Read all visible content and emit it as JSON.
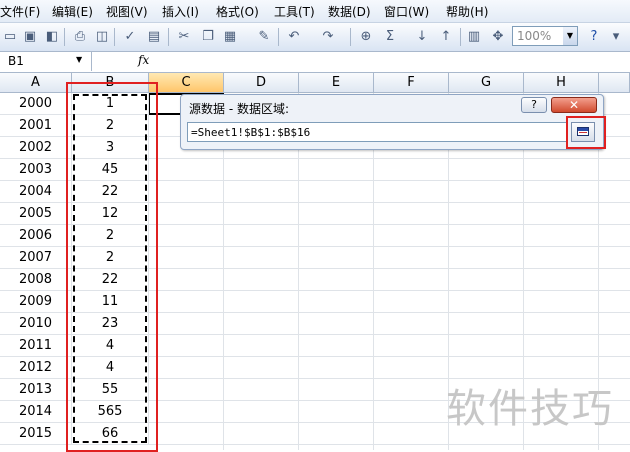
{
  "menu": [
    "文件(F)",
    "编辑(E)",
    "视图(V)",
    "插入(I)",
    "格式(O)",
    "工具(T)",
    "数据(D)",
    "窗口(W)",
    "帮助(H)"
  ],
  "toolbar": {
    "zoom_value": "100%",
    "icons": [
      "new-icon",
      "save-icon",
      "permission-icon",
      "print-icon",
      "print-preview-icon",
      "spelling-icon",
      "research-icon",
      "cut-icon",
      "copy-icon",
      "paste-icon",
      "format-painter-icon",
      "undo-icon",
      "redo-icon",
      "hyperlink-icon",
      "autosum-icon",
      "sort-ascending-icon",
      "sort-descending-icon",
      "chart-wizard-icon",
      "drawing-icon",
      "help-icon"
    ]
  },
  "formula_bar": {
    "name_box": "B1",
    "fx_label": "fx"
  },
  "columns": [
    "A",
    "B",
    "C",
    "D",
    "E",
    "F",
    "G",
    "H"
  ],
  "rows": [
    {
      "a": "2000",
      "b": "1"
    },
    {
      "a": "2001",
      "b": "2"
    },
    {
      "a": "2002",
      "b": "3"
    },
    {
      "a": "2003",
      "b": "45"
    },
    {
      "a": "2004",
      "b": "22"
    },
    {
      "a": "2005",
      "b": "12"
    },
    {
      "a": "2006",
      "b": "2"
    },
    {
      "a": "2007",
      "b": "2"
    },
    {
      "a": "2008",
      "b": "22"
    },
    {
      "a": "2009",
      "b": "11"
    },
    {
      "a": "2010",
      "b": "23"
    },
    {
      "a": "2011",
      "b": "4"
    },
    {
      "a": "2012",
      "b": "4"
    },
    {
      "a": "2013",
      "b": "55"
    },
    {
      "a": "2014",
      "b": "565"
    },
    {
      "a": "2015",
      "b": "66"
    }
  ],
  "dialog": {
    "title": "源数据 - 数据区域:",
    "help_label": "?",
    "close_label": "✕",
    "range_value": "=Sheet1!$B$1:$B$16"
  },
  "watermark": "软件技巧",
  "colors": {
    "highlight_red": "#e02020",
    "active_column_header": "#ffc66b"
  }
}
